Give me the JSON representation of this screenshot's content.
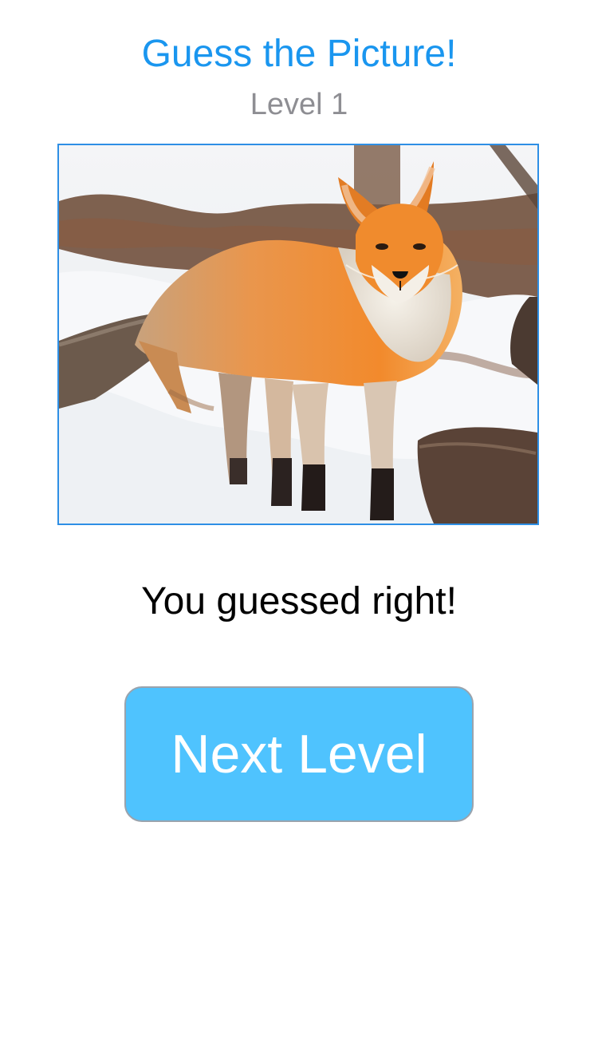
{
  "header": {
    "title": "Guess the Picture!",
    "level_label": "Level 1"
  },
  "puzzle": {
    "image_subject": "fox"
  },
  "feedback": {
    "message": "You guessed right!"
  },
  "actions": {
    "next_level_label": "Next Level"
  },
  "colors": {
    "title": "#1a96ef",
    "level": "#8e8e93",
    "image_border": "#2e8fe5",
    "button_background": "#4fc3fe",
    "button_text": "#ffffff",
    "message": "#000000"
  }
}
